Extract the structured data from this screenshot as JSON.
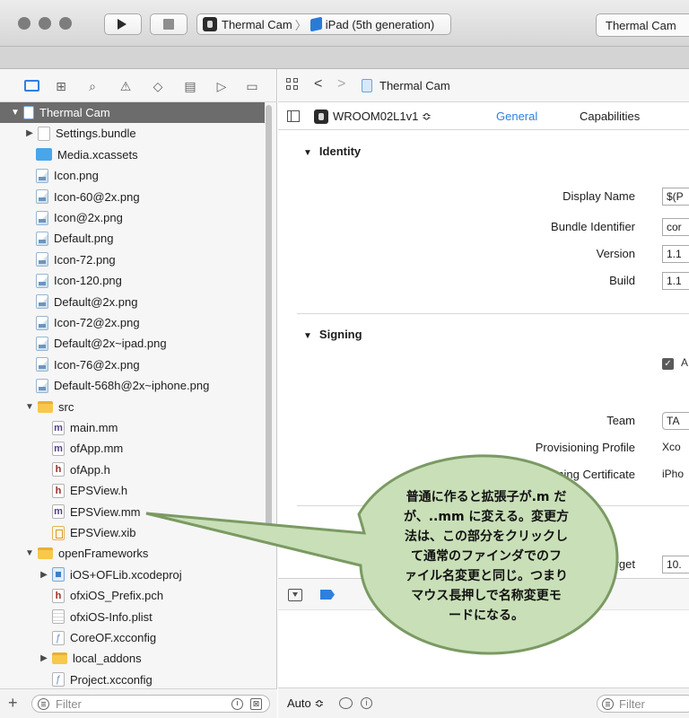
{
  "toolbar": {
    "scheme_target": "Thermal Cam",
    "scheme_device": "iPad (5th generation)",
    "status_text": "Thermal Cam"
  },
  "navigator": {
    "items": [
      {
        "label": "Thermal Cam",
        "icon": "project-icon",
        "level": 0,
        "disclosure": "open",
        "selected": true
      },
      {
        "label": "Settings.bundle",
        "icon": "bundle-icon",
        "level": 1,
        "disclosure": "closed"
      },
      {
        "label": "Media.xcassets",
        "icon": "asset-catalog-icon",
        "level": 1
      },
      {
        "label": "Icon.png",
        "icon": "png-icon",
        "level": 1
      },
      {
        "label": "Icon-60@2x.png",
        "icon": "png-icon",
        "level": 1
      },
      {
        "label": "Icon@2x.png",
        "icon": "png-icon",
        "level": 1
      },
      {
        "label": "Default.png",
        "icon": "png-icon",
        "level": 1
      },
      {
        "label": "Icon-72.png",
        "icon": "png-icon",
        "level": 1
      },
      {
        "label": "Icon-120.png",
        "icon": "png-icon",
        "level": 1
      },
      {
        "label": "Default@2x.png",
        "icon": "png-icon",
        "level": 1
      },
      {
        "label": "Icon-72@2x.png",
        "icon": "png-icon",
        "level": 1
      },
      {
        "label": "Default@2x~ipad.png",
        "icon": "png-icon",
        "level": 1
      },
      {
        "label": "Icon-76@2x.png",
        "icon": "png-icon",
        "level": 1
      },
      {
        "label": "Default-568h@2x~iphone.png",
        "icon": "png-icon",
        "level": 1
      },
      {
        "label": "src",
        "icon": "folder-icon",
        "level": 1,
        "disclosure": "open"
      },
      {
        "label": "main.mm",
        "icon": "m-file-icon",
        "level": 2
      },
      {
        "label": "ofApp.mm",
        "icon": "m-file-icon",
        "level": 2
      },
      {
        "label": "ofApp.h",
        "icon": "h-file-icon",
        "level": 2
      },
      {
        "label": "EPSView.h",
        "icon": "h-file-icon",
        "level": 2
      },
      {
        "label": "EPSView.mm",
        "icon": "m-file-icon",
        "level": 2
      },
      {
        "label": "EPSView.xib",
        "icon": "xib-icon",
        "level": 2
      },
      {
        "label": "openFrameworks",
        "icon": "folder-icon",
        "level": 1,
        "disclosure": "open"
      },
      {
        "label": "iOS+OFLib.xcodeproj",
        "icon": "xcodeproj-icon",
        "level": 2,
        "disclosure": "closed"
      },
      {
        "label": "ofxiOS_Prefix.pch",
        "icon": "h-file-icon",
        "level": 2
      },
      {
        "label": "ofxiOS-Info.plist",
        "icon": "plist-icon",
        "level": 2
      },
      {
        "label": "CoreOF.xcconfig",
        "icon": "xcconfig-icon",
        "level": 2
      },
      {
        "label": "local_addons",
        "icon": "folder-icon",
        "level": 2,
        "disclosure": "closed"
      },
      {
        "label": "Project.xcconfig",
        "icon": "xcconfig-icon",
        "level": 2
      }
    ],
    "filter_placeholder": "Filter"
  },
  "editor": {
    "breadcrumb": "Thermal Cam",
    "target_name": "WROOM02L1v1 ≎",
    "tab_general": "General",
    "tab_capabilities": "Capabilities",
    "identity": {
      "title": "Identity",
      "display_name_label": "Display Name",
      "display_name_value": "$(P",
      "bundle_id_label": "Bundle Identifier",
      "bundle_id_value": "cor",
      "version_label": "Version",
      "version_value": "1.1",
      "build_label": "Build",
      "build_value": "1.1"
    },
    "signing": {
      "title": "Signing",
      "team_label": "Team",
      "team_value": "TA",
      "provisioning_label": "Provisioning Profile",
      "provisioning_value": "Xco",
      "certificate_label": "igning Certificate",
      "certificate_value": "iPho",
      "checkbox_partial": "A"
    },
    "deployment": {
      "target_label": "Target",
      "target_value": "10."
    },
    "console_auto": "Auto ≎",
    "console_filter_placeholder": "Filter"
  },
  "callout": {
    "lines": [
      "普通に作ると拡張子が.m だ",
      "が、..mm に変える。変更方",
      "法は、この部分をクリックし",
      "て通常のファインダでのフ",
      "ァイル名変更と同じ。つまり",
      "マウス長押しで名称変更モ",
      "ードになる。"
    ],
    "fill_color": "#c9dfb8",
    "stroke_color": "#7a9a62"
  }
}
